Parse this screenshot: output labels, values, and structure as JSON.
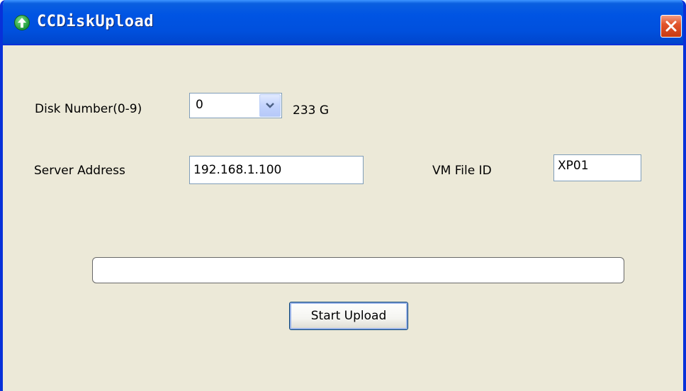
{
  "window": {
    "title": "CCDiskUpload",
    "icon": "upload-arrow-icon",
    "close_icon": "close-icon"
  },
  "form": {
    "disk_number_label": "Disk Number(0-9)",
    "disk_number_value": "0",
    "disk_size": "233 G",
    "server_address_label": "Server Address",
    "server_address_value": "192.168.1.100",
    "vm_file_id_label": "VM File ID",
    "vm_file_id_value": "XP01"
  },
  "progress": {
    "value_percent": 0
  },
  "actions": {
    "start_upload_label": "Start Upload"
  },
  "colors": {
    "titlebar": "#0054e3",
    "window_bg": "#ece9d8",
    "close_button": "#e2552c"
  }
}
